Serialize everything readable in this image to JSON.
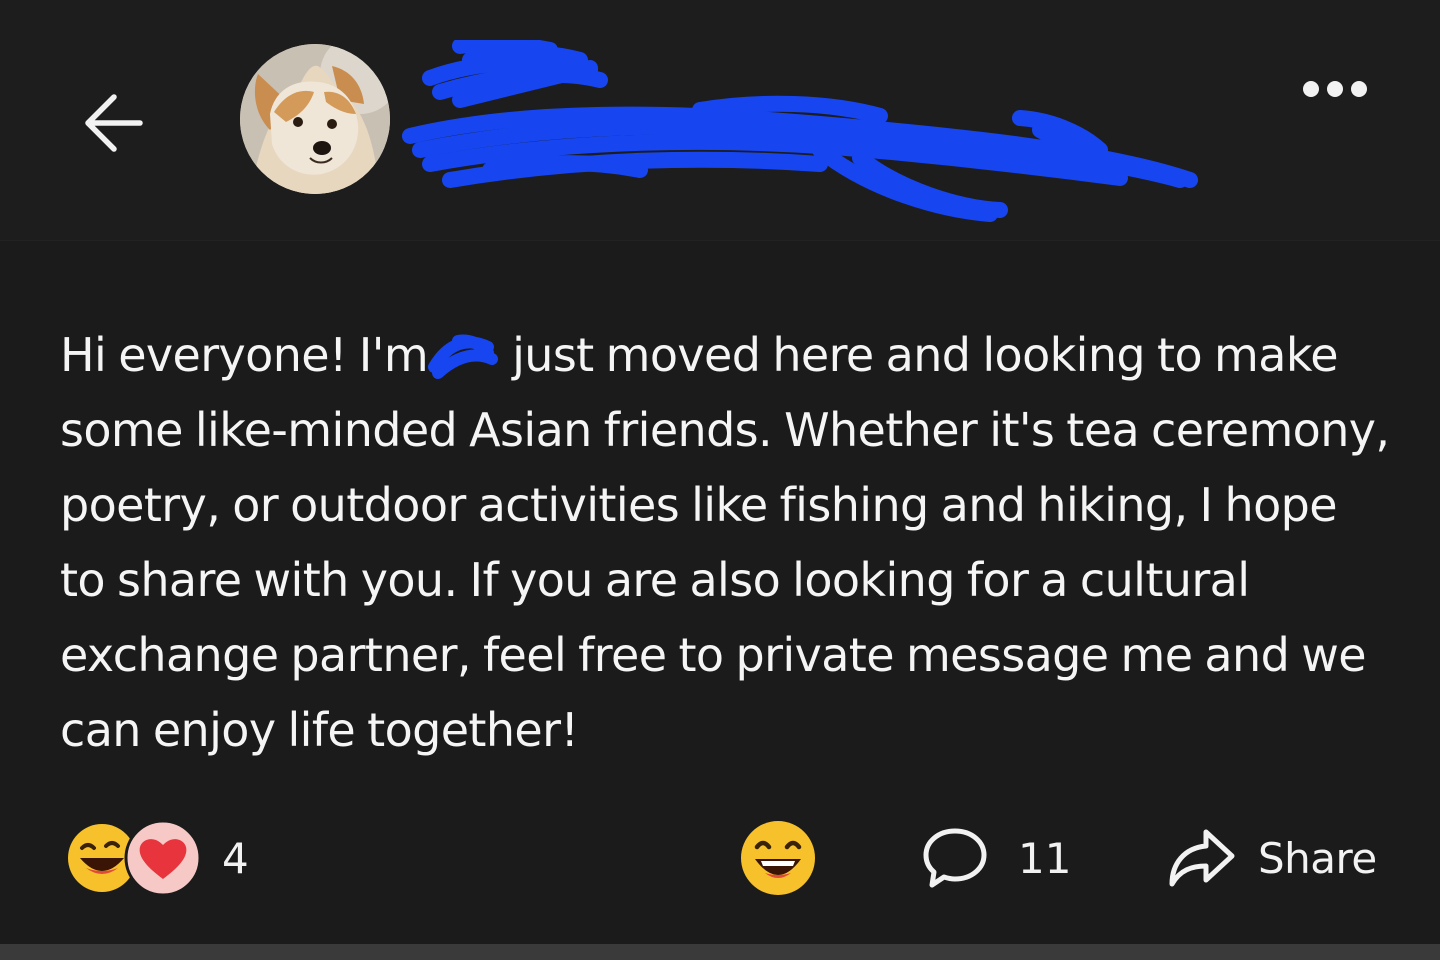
{
  "header": {
    "back_icon": "arrow-left-icon",
    "avatar_icon": "dog-avatar",
    "author_name": "",
    "more_icon": "more-dots-icon"
  },
  "post": {
    "text_before_name": "Hi everyone! I'm",
    "text_after_name": "just moved here and looking to make some like-minded Asian friends. Whether it's tea ceremony, poetry, or outdoor activities like fishing and hiking, I hope to share with you. If you are also looking for a cultural exchange partner, feel free to private message me and we can enjoy life together!"
  },
  "footer": {
    "reaction_count": "4",
    "comment_count": "11",
    "share_label": "Share"
  },
  "colors": {
    "background": "#1b1b1b",
    "text": "#f5f5f5",
    "redaction": "#1746f0",
    "heart": "#e8343d",
    "emoji_yellow": "#f7c12b"
  }
}
